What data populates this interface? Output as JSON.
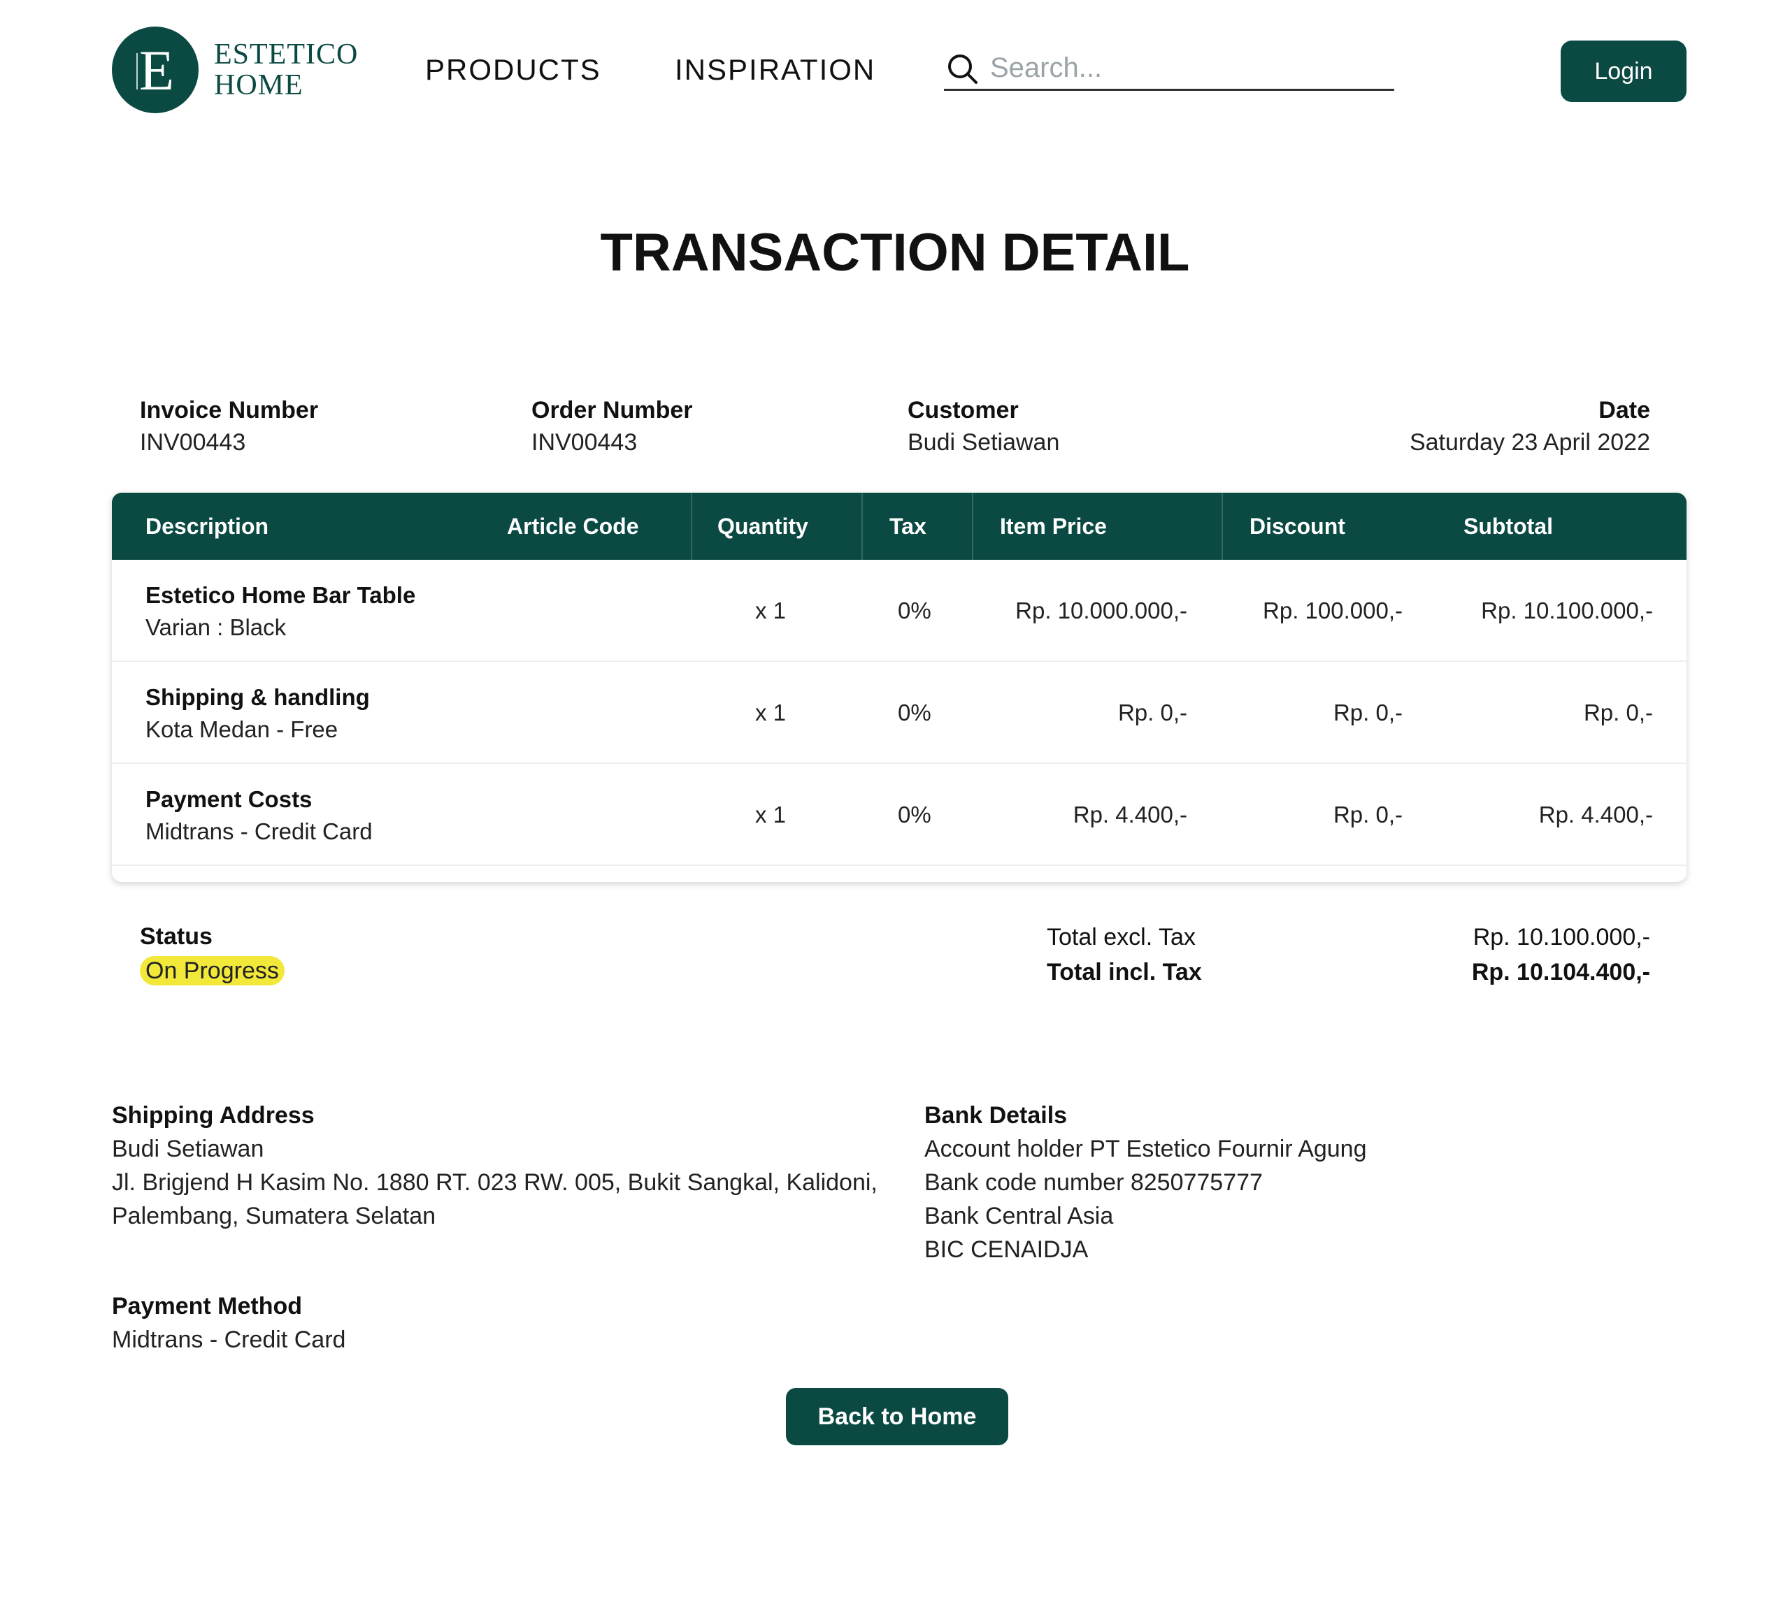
{
  "brand": {
    "name_line1": "ESTETICO",
    "name_line2": "HOME",
    "monogram": "E",
    "color": "#0b4a43"
  },
  "nav": {
    "products": "PRODUCTS",
    "inspiration": "INSPIRATION"
  },
  "search": {
    "placeholder": "Search...",
    "icon": "search-icon"
  },
  "login": {
    "label": "Login"
  },
  "page_title": "TRANSACTION DETAIL",
  "meta": {
    "invoice_label": "Invoice Number",
    "invoice_value": "INV00443",
    "order_label": "Order Number",
    "order_value": "INV00443",
    "customer_label": "Customer",
    "customer_value": "Budi Setiawan",
    "date_label": "Date",
    "date_value": "Saturday 23 April 2022"
  },
  "table": {
    "headers": [
      "Description",
      "Article Code",
      "Quantity",
      "Tax",
      "Item Price",
      "Discount",
      "Subtotal"
    ],
    "rows": [
      {
        "title": "Estetico Home Bar Table",
        "subtitle": "Varian : Black",
        "article_code": "",
        "qty": "x 1",
        "tax": "0%",
        "price": "Rp. 10.000.000,-",
        "discount": "Rp. 100.000,-",
        "subtotal": "Rp. 10.100.000,-"
      },
      {
        "title": "Shipping & handling",
        "subtitle": "Kota Medan - Free",
        "article_code": "",
        "qty": "x 1",
        "tax": "0%",
        "price": "Rp. 0,-",
        "discount": "Rp. 0,-",
        "subtotal": "Rp. 0,-"
      },
      {
        "title": "Payment Costs",
        "subtitle": "Midtrans - Credit Card",
        "article_code": "",
        "qty": "x 1",
        "tax": "0%",
        "price": "Rp. 4.400,-",
        "discount": "Rp. 0,-",
        "subtotal": "Rp. 4.400,-"
      }
    ]
  },
  "status": {
    "label": "Status",
    "value": "On Progress",
    "badge_color": "#f2e83a"
  },
  "totals": {
    "excl_label": "Total excl. Tax",
    "excl_value": "Rp. 10.100.000,-",
    "incl_label": "Total incl. Tax",
    "incl_value": "Rp. 10.104.400,-"
  },
  "shipping_address": {
    "label": "Shipping Address",
    "name": "Budi Setiawan",
    "line1": "Jl. Brigjend H Kasim No. 1880 RT. 023 RW. 005, Bukit Sangkal, Kalidoni,",
    "line2": "Palembang, Sumatera Selatan"
  },
  "bank_details": {
    "label": "Bank Details",
    "holder": "Account holder PT Estetico Fournir Agung",
    "code": "Bank code number 8250775777",
    "bank": "Bank Central Asia",
    "bic": "BIC CENAIDJA"
  },
  "payment_method": {
    "label": "Payment Method",
    "value": "Midtrans - Credit Card"
  },
  "back_button": {
    "label": "Back to Home"
  }
}
